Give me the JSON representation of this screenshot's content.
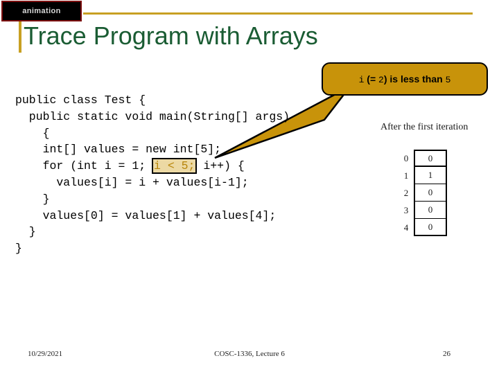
{
  "tab": {
    "label": "animation"
  },
  "title": "Trace Program with Arrays",
  "callout": {
    "part_var": "i",
    "part_mid": " (= ",
    "part_value": "2",
    "part_mid2": ") is less than ",
    "part_limit": "5",
    "full_text": "i (= 2) is less than 5"
  },
  "code": {
    "line1": "public class Test {",
    "line2": "  public static void main(String[] args)",
    "line3": "    {",
    "line4": "    int[] values = new int[5];",
    "line5_pre": "    for (int i = 1; ",
    "line5_hl": "i < 5;",
    "line5_post": " i++) {",
    "line6": "      values[i] = i + values[i-1];",
    "line7": "    }",
    "line8": "    values[0] = values[1] + values[4];",
    "line9": "  }",
    "line10": "}"
  },
  "array_panel": {
    "caption": "After the first iteration",
    "rows": [
      {
        "index": "0",
        "value": "0"
      },
      {
        "index": "1",
        "value": "1"
      },
      {
        "index": "2",
        "value": "0"
      },
      {
        "index": "3",
        "value": "0"
      },
      {
        "index": "4",
        "value": "0"
      }
    ]
  },
  "footer": {
    "date": "10/29/2021",
    "center": "COSC-1336, Lecture 6",
    "page": "26"
  },
  "colors": {
    "gold": "#c8930a",
    "gold_rule": "#c8a022",
    "title_green": "#1a5c33",
    "tab_border": "#7d1010",
    "highlight_bg": "#ecd9a4",
    "highlight_fg": "#b8860b"
  }
}
